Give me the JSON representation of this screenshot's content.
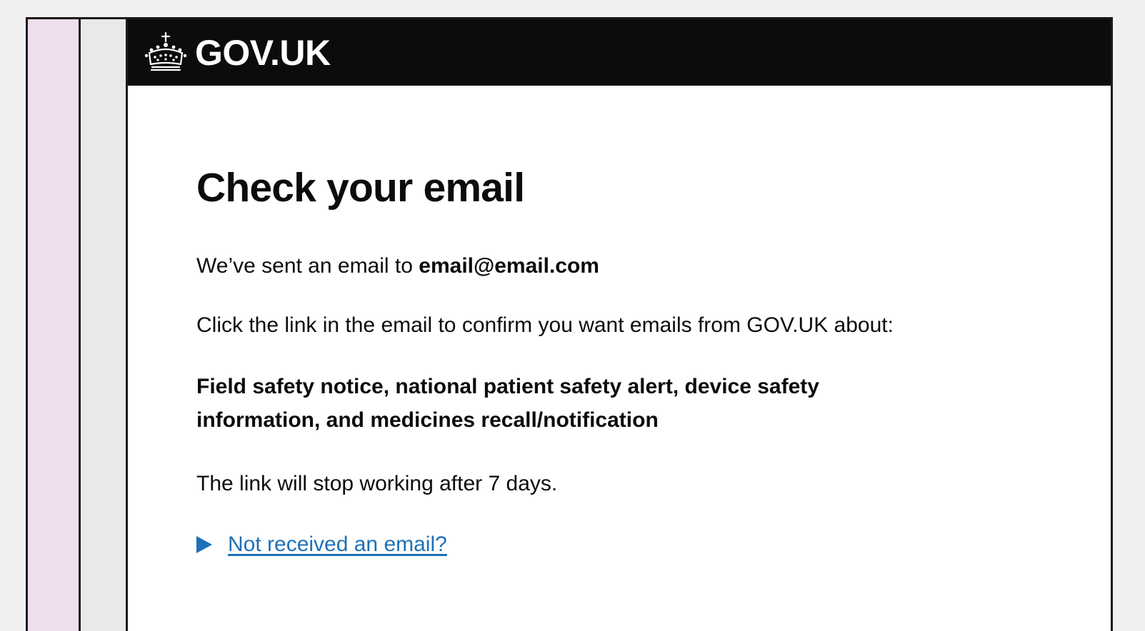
{
  "header": {
    "brand": "GOV.UK",
    "logo_icon": "crown-icon"
  },
  "main": {
    "title": "Check your email",
    "sent_prefix": "We’ve sent an email to",
    "email": "email@email.com",
    "confirm_text": "Click the link in the email to confirm you want emails from GOV.UK about:",
    "topics": "Field safety notice, national patient safety alert, device safety information, and medicines recall/notification",
    "expiry_text": "The link will stop working after 7 days.",
    "details_label": "Not received an email?"
  },
  "colors": {
    "header_bg": "#0b0c0c",
    "link": "#1d70b8",
    "text": "#0b0c0c",
    "sidebar_pink": "#efdeee",
    "sidebar_gray": "#e8e9ea"
  }
}
